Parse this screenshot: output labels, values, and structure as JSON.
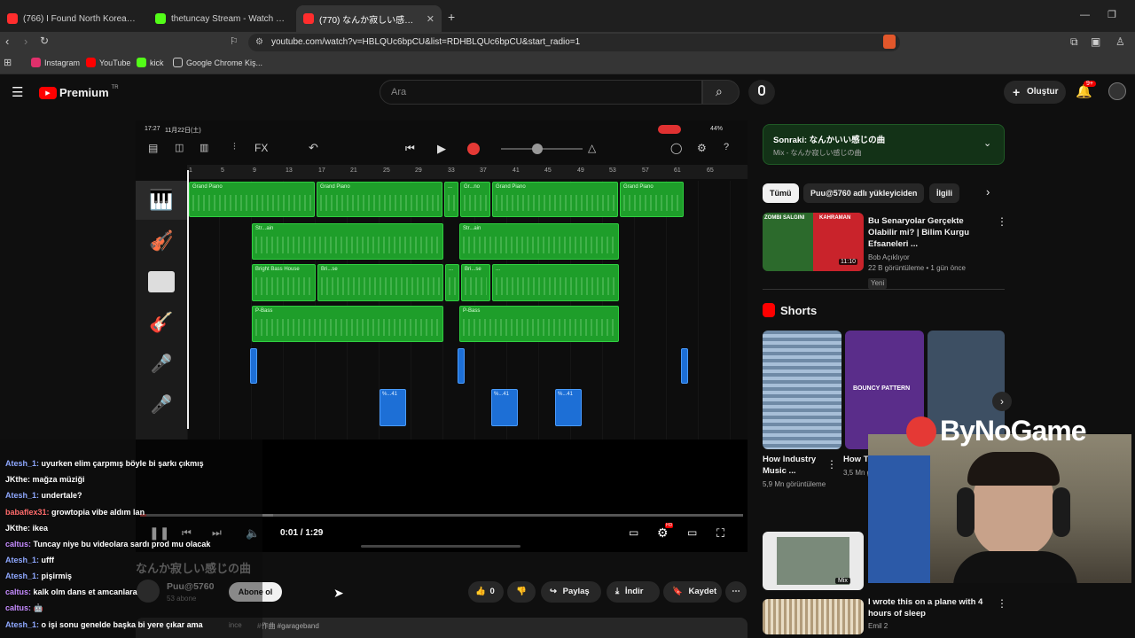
{
  "tabs": [
    {
      "title": "(766) I Found North Korean Spies on",
      "fav": "#ff2d2d",
      "x": "tab1"
    },
    {
      "title": "thetuncay Stream - Watch Live on Ki",
      "fav": "#53fc18"
    },
    {
      "title": "(770) なんか寂しい感じの曲 - Yo",
      "fav": "#ff2d2d"
    }
  ],
  "tab_close": "✕",
  "new_tab": "+",
  "url": "youtube.com/watch?v=HBLQUc6bpCU&list=RDHBLQUc6bpCU&start_radio=1",
  "bookmarks": [
    {
      "label": "Instagram",
      "color": "#e1306c"
    },
    {
      "label": "YouTube",
      "color": "#ff0000"
    },
    {
      "label": "kick",
      "color": "#53fc18"
    },
    {
      "label": "Google Chrome Kiş...",
      "color": "#888888"
    }
  ],
  "yt": {
    "logo_text": "Premium",
    "logo_sup": "TR",
    "search_placeholder": "Ara",
    "create_label": "Oluştur",
    "notif_badge": "9+"
  },
  "daw": {
    "status_time": "17:27",
    "status_date": "11月22日(土)",
    "battery": "44%",
    "fx_label": "FX",
    "ruler_ticks": [
      "1",
      "5",
      "9",
      "13",
      "17",
      "21",
      "25",
      "29",
      "33",
      "37",
      "41",
      "45",
      "49",
      "53",
      "57",
      "61",
      "65"
    ],
    "regions": [
      {
        "label": "Grand Piano"
      },
      {
        "label": "Grand Piano"
      },
      {
        "label": "..."
      },
      {
        "label": "Gr...no"
      },
      {
        "label": "Grand Piano"
      },
      {
        "label": "Grand Piano"
      },
      {
        "label": "Str...ain"
      },
      {
        "label": "Str...ain"
      },
      {
        "label": "Bright Bass House"
      },
      {
        "label": "Bri...se"
      },
      {
        "label": "..."
      },
      {
        "label": "Bri...se"
      },
      {
        "label": "..."
      },
      {
        "label": "P-Bass"
      },
      {
        "label": "P-Bass"
      }
    ],
    "blue_regions": [
      "%...41",
      "%...41",
      "%...41"
    ]
  },
  "player": {
    "time": "0:01 / 1:29",
    "overlay_title": "なんか寂しい感じの曲",
    "progress": 0.01,
    "hd_badge": "HD"
  },
  "chat": [
    {
      "user": "Atesh_1:",
      "msg": "uyurken elim çarpmış böyle bi şarkı çıkmış",
      "color": "#8fa8ff"
    },
    {
      "user": "JKthe:",
      "msg": "mağza müziği",
      "color": "#ffffff"
    },
    {
      "user": "Atesh_1:",
      "msg": "undertale?",
      "color": "#8fa8ff"
    },
    {
      "user": "babaflex31:",
      "msg": "growtopia vibe aldım lan",
      "color": "#ff6b6b"
    },
    {
      "user": "JKthe:",
      "msg": "ikea",
      "color": "#ffffff"
    },
    {
      "user": "caltus:",
      "msg": "Tuncay niye bu videolara sardı prod mu olacak",
      "color": "#c58bff"
    },
    {
      "user": "Atesh_1:",
      "msg": "ufff",
      "color": "#8fa8ff"
    },
    {
      "user": "Atesh_1:",
      "msg": "pişirmiş",
      "color": "#8fa8ff"
    },
    {
      "user": "caltus:",
      "msg": "kalk olm dans et amcanlara",
      "color": "#c58bff"
    },
    {
      "user": "caltus:",
      "msg": "🤖",
      "color": "#c58bff"
    },
    {
      "user": "Atesh_1:",
      "msg": "o işi sonu genelde başka bi yere çıkar ama",
      "color": "#8fa8ff"
    }
  ],
  "channel": {
    "name": "Puu@5760",
    "subs": "53 abone",
    "subscribe": "Abone ol"
  },
  "actions": {
    "likes": "0",
    "share": "Paylaş",
    "download": "İndir",
    "save": "Kaydet"
  },
  "hashtags": "#作曲 #garageband",
  "desc_fragment": "ince",
  "next": {
    "label": "Sonraki:",
    "title": "なんかいい感じの曲",
    "sub": "Mix - なんか寂しい感じの曲"
  },
  "chips": [
    "Tümü",
    "Puu@5760 adlı yükleyiciden",
    "İlgili"
  ],
  "rec1": {
    "title": "Bu Senaryolar Gerçekte Olabilir mi? | Bilim Kurgu Efsaneleri ...",
    "channel": "Bob Açıklıyor",
    "meta": "22 B görüntüleme • 1 gün önce",
    "badge": "Yeni",
    "duration": "11:10",
    "thumb_left": "ZOMBI SALGINI",
    "thumb_right": "KAHRAMAN"
  },
  "shorts": {
    "heading": "Shorts",
    "items": [
      {
        "title": "How Industry Music ...",
        "views": "5,9 Mn görüntüleme"
      },
      {
        "title": "How T Make",
        "views": "3,5 Mn görüntüleme"
      }
    ],
    "bouncy": "BOUNCY PATTERN"
  },
  "rec2": {
    "title": "I wrote this on a plane with 4 hours of sleep",
    "channel": "Emil 2",
    "mix": "Mix"
  },
  "webcam": {
    "brand": "ByNoGame"
  },
  "colors": {
    "accent_red": "#ff0000",
    "region_green": "#1e9e2a",
    "region_blue": "#1d6fd6"
  }
}
